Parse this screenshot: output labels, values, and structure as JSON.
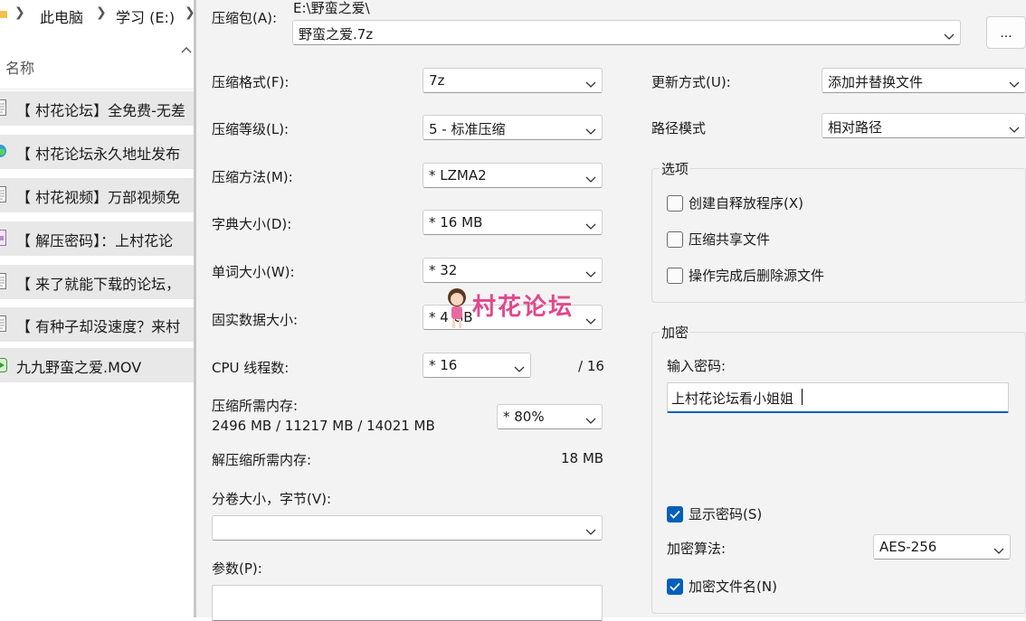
{
  "explorer": {
    "breadcrumb": [
      "此电脑",
      "学习 (E:)"
    ],
    "column_header": "名称",
    "files": [
      {
        "name": "【 村花论坛】全免费-无差",
        "icon": "text-file-icon"
      },
      {
        "name": "【 村花论坛永久地址发布",
        "icon": "edge-browser-icon"
      },
      {
        "name": "【 村花视频】万部视频免",
        "icon": "text-file-icon"
      },
      {
        "name": "【 解压密码】：上村花论",
        "icon": "archive-icon"
      },
      {
        "name": "【 来了就能下载的论坛，",
        "icon": "text-file-icon"
      },
      {
        "name": "【 有种子却没速度？来村",
        "icon": "text-file-icon"
      },
      {
        "name": "九九野蛮之爱.MOV",
        "icon": "video-file-icon"
      }
    ]
  },
  "dialog": {
    "archive_label": "压缩包(A):",
    "archive_path": "E:\\野蛮之爱\\",
    "archive_name": "野蛮之爱.7z",
    "browse_label": "...",
    "format_label": "压缩格式(F):",
    "format_value": "7z",
    "level_label": "压缩等级(L):",
    "level_value": "5 - 标准压缩",
    "method_label": "压缩方法(M):",
    "method_value": "*  LZMA2",
    "dict_label": "字典大小(D):",
    "dict_value": "*  16 MB",
    "word_label": "单词大小(W):",
    "word_value": "*  32",
    "solid_label": "固实数据大小:",
    "solid_value": "*  4 GB",
    "cpu_label": "CPU 线程数:",
    "cpu_value": "*  16",
    "cpu_total": "/ 16",
    "mem_label": "压缩所需内存:",
    "mem_value": "2496 MB / 11217 MB / 14021 MB",
    "mem_percent": "* 80%",
    "decomp_label": "解压缩所需内存:",
    "decomp_value": "18 MB",
    "volume_label": "分卷大小，字节(V):",
    "volume_value": "",
    "params_label": "参数(P):",
    "params_value": "",
    "update_label": "更新方式(U):",
    "update_value": "添加并替换文件",
    "path_label": "路径模式",
    "path_value": "相对路径",
    "options_title": "选项",
    "options": [
      {
        "label": "创建自释放程序(X)",
        "checked": false
      },
      {
        "label": "压缩共享文件",
        "checked": false
      },
      {
        "label": "操作完成后删除源文件",
        "checked": false
      }
    ],
    "encryption_title": "加密",
    "password_label": "输入密码:",
    "password_value": "上村花论坛看小姐姐",
    "show_password_label": "显示密码(S)",
    "show_password_checked": true,
    "algo_label": "加密算法:",
    "algo_value": "AES-256",
    "encrypt_names_label": "加密文件名(N)",
    "encrypt_names_checked": true
  },
  "watermark": {
    "text": "村花论坛"
  },
  "colors": {
    "accent": "#005fb8",
    "window_bg": "#f3f3f3",
    "watermark": "#e0488b"
  }
}
